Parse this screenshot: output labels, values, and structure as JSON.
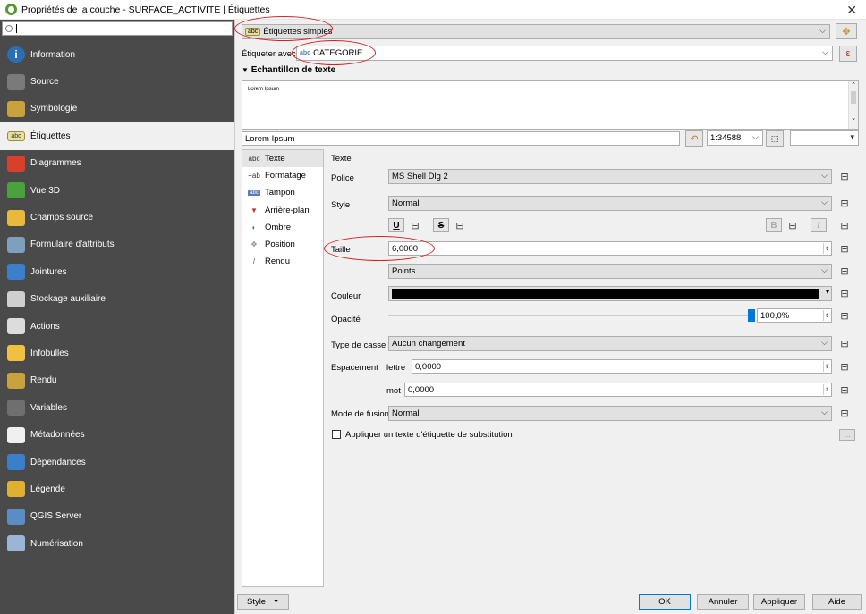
{
  "window": {
    "title": "Propriétés de la couche - SURFACE_ACTIVITE | Étiquettes"
  },
  "sidebar": {
    "search_value": "",
    "items": [
      {
        "label": "Information",
        "icon": "info-icon",
        "color": "#2a6fb4"
      },
      {
        "label": "Source",
        "icon": "tools-icon",
        "color": "#7a7a7a"
      },
      {
        "label": "Symbologie",
        "icon": "brush-icon",
        "color": "#c9a23e"
      },
      {
        "label": "Étiquettes",
        "icon": "abc-icon",
        "color": "#e7e0a0"
      },
      {
        "label": "Diagrammes",
        "icon": "diagram-icon",
        "color": "#d9402c"
      },
      {
        "label": "Vue 3D",
        "icon": "cube-icon",
        "color": "#4aa23d"
      },
      {
        "label": "Champs source",
        "icon": "fields-icon",
        "color": "#e8b93b"
      },
      {
        "label": "Formulaire d'attributs",
        "icon": "form-icon",
        "color": "#7f9fbf"
      },
      {
        "label": "Jointures",
        "icon": "join-icon",
        "color": "#3a7fc9"
      },
      {
        "label": "Stockage auxiliaire",
        "icon": "storage-icon",
        "color": "#cfcfcf"
      },
      {
        "label": "Actions",
        "icon": "gear-icon",
        "color": "#dcdcdc"
      },
      {
        "label": "Infobulles",
        "icon": "tooltip-icon",
        "color": "#f0c040"
      },
      {
        "label": "Rendu",
        "icon": "render-icon",
        "color": "#c9a23e"
      },
      {
        "label": "Variables",
        "icon": "variables-icon",
        "color": "#6f6f6f"
      },
      {
        "label": "Métadonnées",
        "icon": "metadata-icon",
        "color": "#f0f0f0"
      },
      {
        "label": "Dépendances",
        "icon": "dependencies-icon",
        "color": "#3a7fc9"
      },
      {
        "label": "Légende",
        "icon": "legend-icon",
        "color": "#e0b030"
      },
      {
        "label": "QGIS Server",
        "icon": "server-icon",
        "color": "#5b8dc4"
      },
      {
        "label": "Numérisation",
        "icon": "digitize-icon",
        "color": "#9bb5d6"
      }
    ]
  },
  "labels_mode": {
    "value": "Étiquettes simples"
  },
  "label_with": {
    "label": "Étiqueter avec",
    "value": "CATEGORIE",
    "expr": "ε"
  },
  "sample": {
    "header": "Echantillon de texte",
    "preview_text": "Lorem Ipsum",
    "input_value": "Lorem Ipsum",
    "scale": "1:34588"
  },
  "tabs": [
    {
      "label": "Texte",
      "icon": "abc"
    },
    {
      "label": "Formatage",
      "icon": "+ab"
    },
    {
      "label": "Tampon",
      "icon": "abc"
    },
    {
      "label": "Arrière-plan",
      "icon": "shield"
    },
    {
      "label": "Ombre",
      "icon": "shadow"
    },
    {
      "label": "Position",
      "icon": "position"
    },
    {
      "label": "Rendu",
      "icon": "render"
    }
  ],
  "text_panel": {
    "heading": "Texte",
    "font_label": "Police",
    "font_value": "MS Shell Dlg 2",
    "style_label": "Style",
    "style_value": "Normal",
    "underline": "U",
    "strike": "S",
    "bold": "B",
    "italic": "I",
    "size_label": "Taille",
    "size_value": "6,0000",
    "units_value": "Points",
    "color_label": "Couleur",
    "color_value": "#000000",
    "opacity_label": "Opacité",
    "opacity_value": "100,0%",
    "opacity_level": 1.0,
    "case_label": "Type de casse",
    "case_value": "Aucun changement",
    "spacing_label": "Espacement",
    "letter_label": "lettre",
    "letter_value": "0,0000",
    "word_label": "mot",
    "word_value": "0,0000",
    "blend_label": "Mode de fusion",
    "blend_value": "Normal",
    "substitute_label": "Appliquer un texte d'étiquette de substitution",
    "ellipsis": "..."
  },
  "footer": {
    "style": "Style",
    "ok": "OK",
    "cancel": "Annuler",
    "apply": "Appliquer",
    "help": "Aide"
  }
}
